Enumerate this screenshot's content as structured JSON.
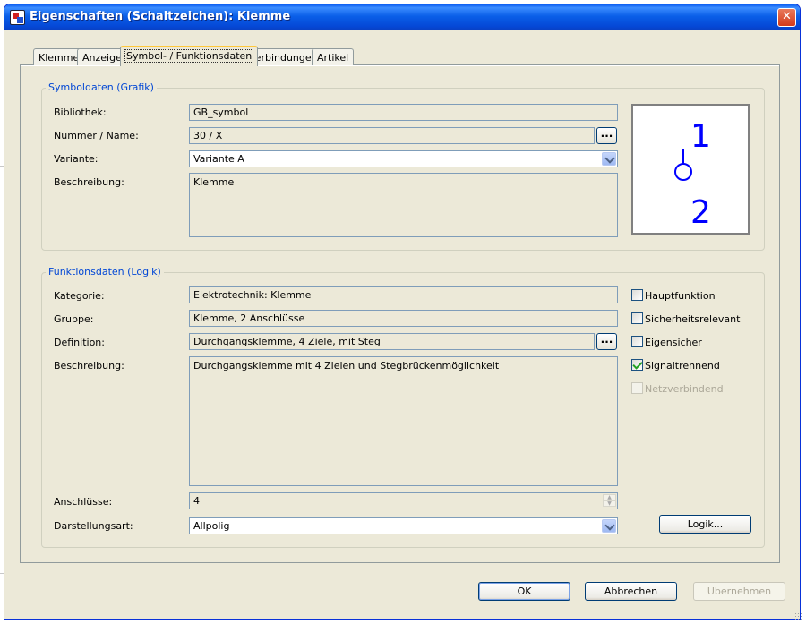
{
  "window": {
    "title": "Eigenschaften (Schaltzeichen): Klemme",
    "close_glyph": "✕"
  },
  "tabs": [
    {
      "label": "Klemme",
      "active": false
    },
    {
      "label": "Anzeige",
      "active": false
    },
    {
      "label": "Symbol- / Funktionsdaten",
      "active": true
    },
    {
      "label": "Verbindungen",
      "active": false
    },
    {
      "label": "Artikel",
      "active": false
    }
  ],
  "symbol": {
    "legend": "Symboldaten (Grafik)",
    "bibliothek_label": "Bibliothek:",
    "bibliothek_value": "GB_symbol",
    "nummer_label": "Nummer / Name:",
    "nummer_value": "30 / X",
    "variante_label": "Variante:",
    "variante_value": "Variante A",
    "beschreibung_label": "Beschreibung:",
    "beschreibung_value": "Klemme",
    "browse_label": "...",
    "preview": {
      "top_number": "1",
      "bottom_number": "2",
      "color": "#0000ff"
    }
  },
  "funktion": {
    "legend": "Funktionsdaten (Logik)",
    "kategorie_label": "Kategorie:",
    "kategorie_value": "Elektrotechnik: Klemme",
    "gruppe_label": "Gruppe:",
    "gruppe_value": "Klemme, 2 Anschlüsse",
    "definition_label": "Definition:",
    "definition_value": "Durchgangsklemme, 4 Ziele, mit Steg",
    "browse_label": "...",
    "beschreibung_label": "Beschreibung:",
    "beschreibung_value": "Durchgangsklemme mit 4 Zielen und Stegbrückenmöglichkeit",
    "anschluesse_label": "Anschlüsse:",
    "anschluesse_value": "4",
    "darstellung_label": "Darstellungsart:",
    "darstellung_value": "Allpolig",
    "checkboxes": {
      "hauptfunktion": {
        "label": "Hauptfunktion",
        "checked": false
      },
      "sicherheit": {
        "label": "Sicherheitsrelevant",
        "checked": false
      },
      "eigensicher": {
        "label": "Eigensicher",
        "checked": false
      },
      "signaltrennend": {
        "label": "Signaltrennend",
        "checked": true
      },
      "netzverbindend": {
        "label": "Netzverbindend",
        "checked": false,
        "disabled": true
      }
    },
    "logik_button": "Logik..."
  },
  "footer": {
    "ok": "OK",
    "cancel": "Abbrechen",
    "apply": "Übernehmen"
  }
}
